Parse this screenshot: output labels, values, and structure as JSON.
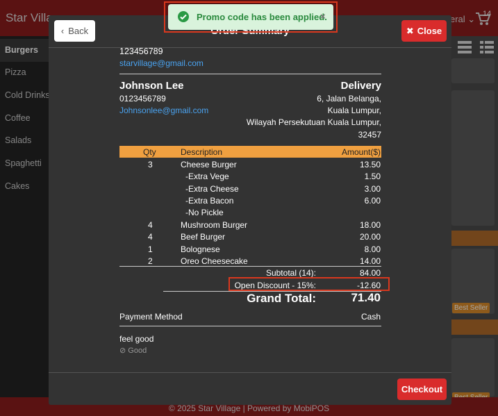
{
  "app": {
    "title": "Star Village",
    "language_label": "eral",
    "cart_count": "14"
  },
  "sidebar": {
    "items": [
      {
        "label": "Burgers",
        "active": true
      },
      {
        "label": "Pizza"
      },
      {
        "label": "Cold Drinks"
      },
      {
        "label": "Coffee"
      },
      {
        "label": "Salads"
      },
      {
        "label": "Spaghetti"
      },
      {
        "label": "Cakes"
      }
    ]
  },
  "background_tags": {
    "best_seller": "Best Seller"
  },
  "footer": {
    "text": "© 2025 Star Village | Powered by MobiPOS"
  },
  "toast": {
    "message": "Promo code has been applied.",
    "close": "×"
  },
  "modal": {
    "title": "Order Summary",
    "back_label": "Back",
    "close_label": "Close",
    "checkout_label": "Checkout",
    "store": {
      "phone": "123456789",
      "email": "starvillage@gmail.com"
    },
    "customer": {
      "name": "Johnson Lee",
      "phone": "0123456789",
      "email": "Johnsonlee@gmail.com",
      "order_type": "Delivery",
      "address_lines": [
        "6, Jalan Belanga,",
        "Kuala Lumpur,",
        "Wilayah Persekutuan Kuala Lumpur,",
        "32457"
      ]
    },
    "table": {
      "headers": {
        "qty": "Qty",
        "description": "Description",
        "amount": "Amount($)"
      },
      "rows": [
        {
          "qty": "3",
          "description": "Cheese Burger",
          "amount": "13.50"
        },
        {
          "qty": "",
          "description": "-Extra Vege",
          "amount": "1.50",
          "modifier": true
        },
        {
          "qty": "",
          "description": "-Extra Cheese",
          "amount": "3.00",
          "modifier": true
        },
        {
          "qty": "",
          "description": "-Extra Bacon",
          "amount": "6.00",
          "modifier": true
        },
        {
          "qty": "",
          "description": "-No Pickle",
          "amount": "",
          "modifier": true
        },
        {
          "qty": "4",
          "description": "Mushroom Burger",
          "amount": "18.00"
        },
        {
          "qty": "4",
          "description": "Beef Burger",
          "amount": "20.00"
        },
        {
          "qty": "1",
          "description": "Bolognese",
          "amount": "8.00"
        },
        {
          "qty": "2",
          "description": "Oreo Cheesecake",
          "amount": "14.00"
        }
      ]
    },
    "totals": {
      "subtotal_label": "Subtotal (14):",
      "subtotal_value": "84.00",
      "discount_label": "Open Discount - 15%:",
      "discount_value": "-12.60",
      "grand_label": "Grand Total:",
      "grand_value": "71.40"
    },
    "payment": {
      "label": "Payment Method",
      "value": "Cash"
    },
    "remark": {
      "text": "feel good",
      "tag": "Good"
    }
  }
}
